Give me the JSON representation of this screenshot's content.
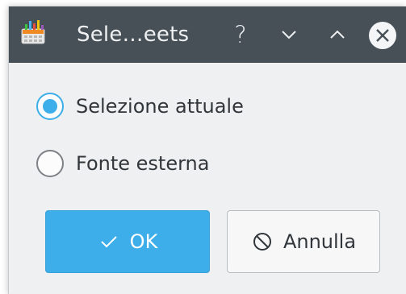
{
  "window": {
    "title": "Sele…eets",
    "titlebar_color": "#475057",
    "background_color": "#eff0f1",
    "accent_color": "#3daee9"
  },
  "titlebar_buttons": {
    "help_label": "?",
    "help_icon": "help-icon",
    "minimize_icon": "chevron-down-icon",
    "maximize_icon": "chevron-up-icon",
    "close_icon": "close-icon"
  },
  "options": [
    {
      "label": "Selezione attuale",
      "checked": true
    },
    {
      "label": "Fonte esterna",
      "checked": false
    }
  ],
  "buttons": {
    "ok_label": "OK",
    "ok_icon": "check-icon",
    "cancel_label": "Annulla",
    "cancel_icon": "cancel-icon"
  }
}
